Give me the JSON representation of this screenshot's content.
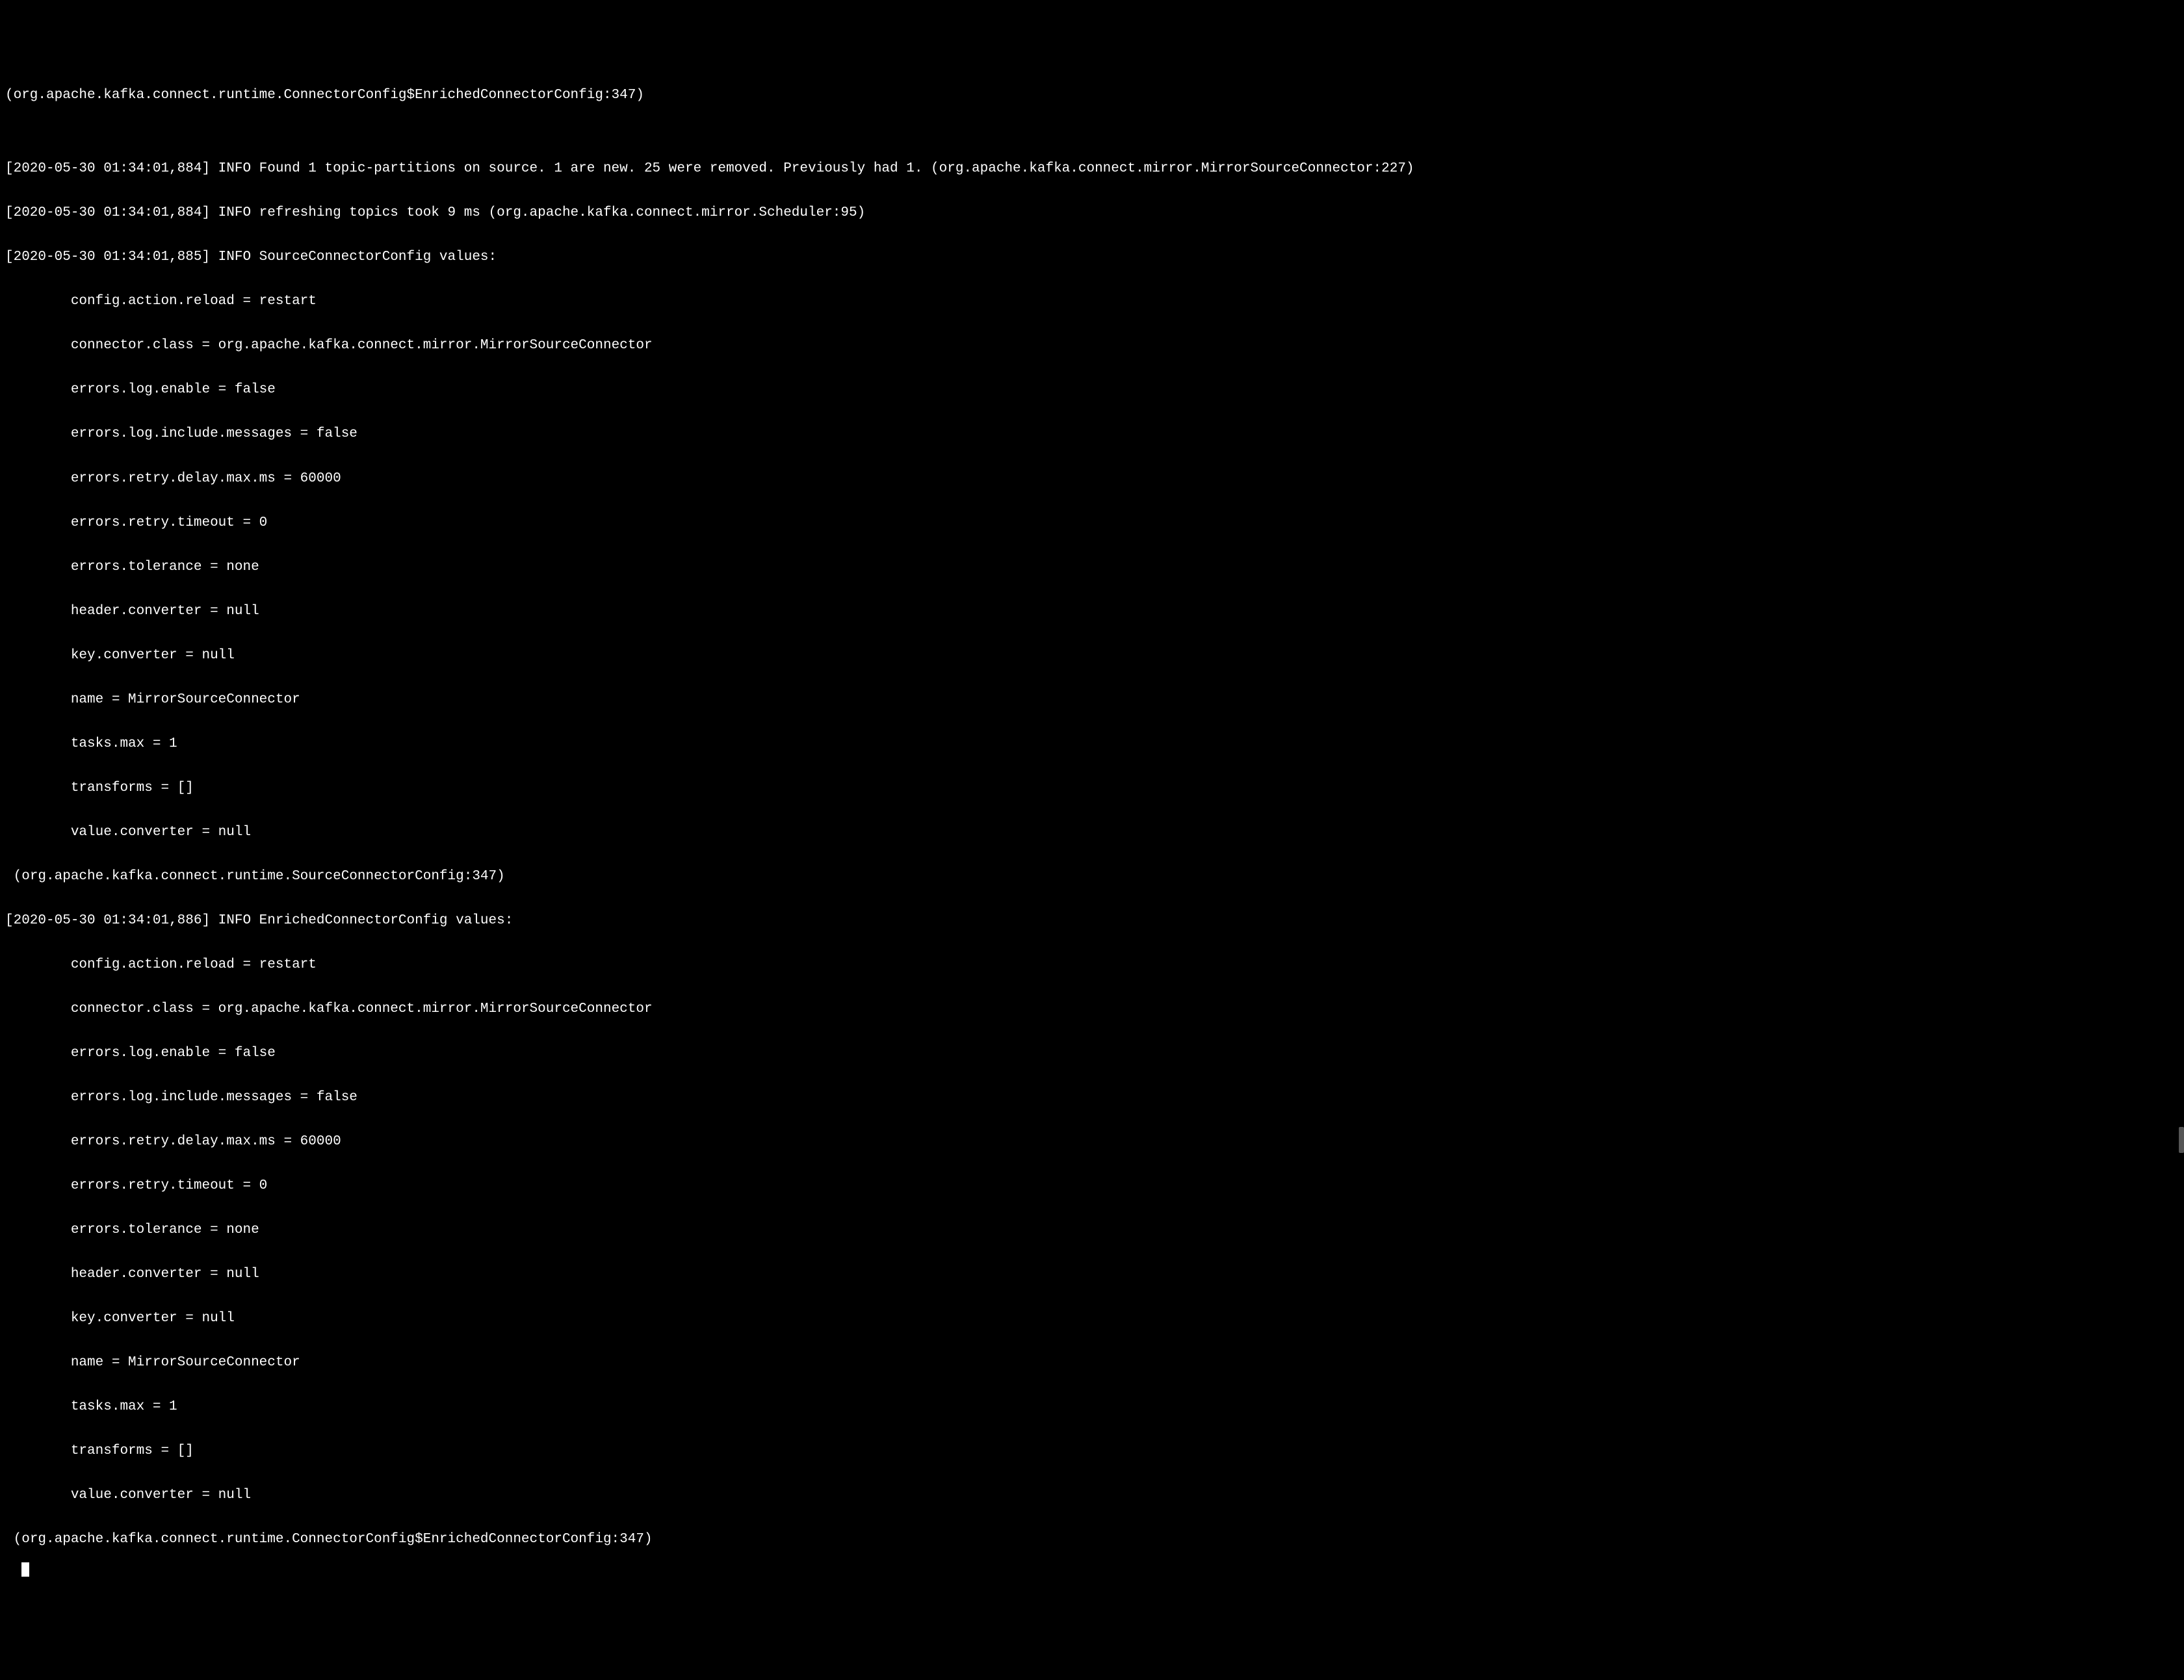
{
  "terminal": {
    "lines": [
      "(org.apache.kafka.connect.runtime.ConnectorConfig$EnrichedConnectorConfig:347)",
      "",
      "[2020-05-30 01:34:01,884] INFO Found 1 topic-partitions on source. 1 are new. 25 were removed. Previously had 1. (org.apache.kafka.connect.mirror.MirrorSourceConnector:227)",
      "[2020-05-30 01:34:01,884] INFO refreshing topics took 9 ms (org.apache.kafka.connect.mirror.Scheduler:95)",
      "[2020-05-30 01:34:01,885] INFO SourceConnectorConfig values: ",
      "        config.action.reload = restart",
      "        connector.class = org.apache.kafka.connect.mirror.MirrorSourceConnector",
      "        errors.log.enable = false",
      "        errors.log.include.messages = false",
      "        errors.retry.delay.max.ms = 60000",
      "        errors.retry.timeout = 0",
      "        errors.tolerance = none",
      "        header.converter = null",
      "        key.converter = null",
      "        name = MirrorSourceConnector",
      "        tasks.max = 1",
      "        transforms = []",
      "        value.converter = null",
      " (org.apache.kafka.connect.runtime.SourceConnectorConfig:347)",
      "[2020-05-30 01:34:01,886] INFO EnrichedConnectorConfig values: ",
      "        config.action.reload = restart",
      "        connector.class = org.apache.kafka.connect.mirror.MirrorSourceConnector",
      "        errors.log.enable = false",
      "        errors.log.include.messages = false",
      "        errors.retry.delay.max.ms = 60000",
      "        errors.retry.timeout = 0",
      "        errors.tolerance = none",
      "        header.converter = null",
      "        key.converter = null",
      "        name = MirrorSourceConnector",
      "        tasks.max = 1",
      "        transforms = []",
      "        value.converter = null",
      " (org.apache.kafka.connect.runtime.ConnectorConfig$EnrichedConnectorConfig:347)"
    ]
  }
}
